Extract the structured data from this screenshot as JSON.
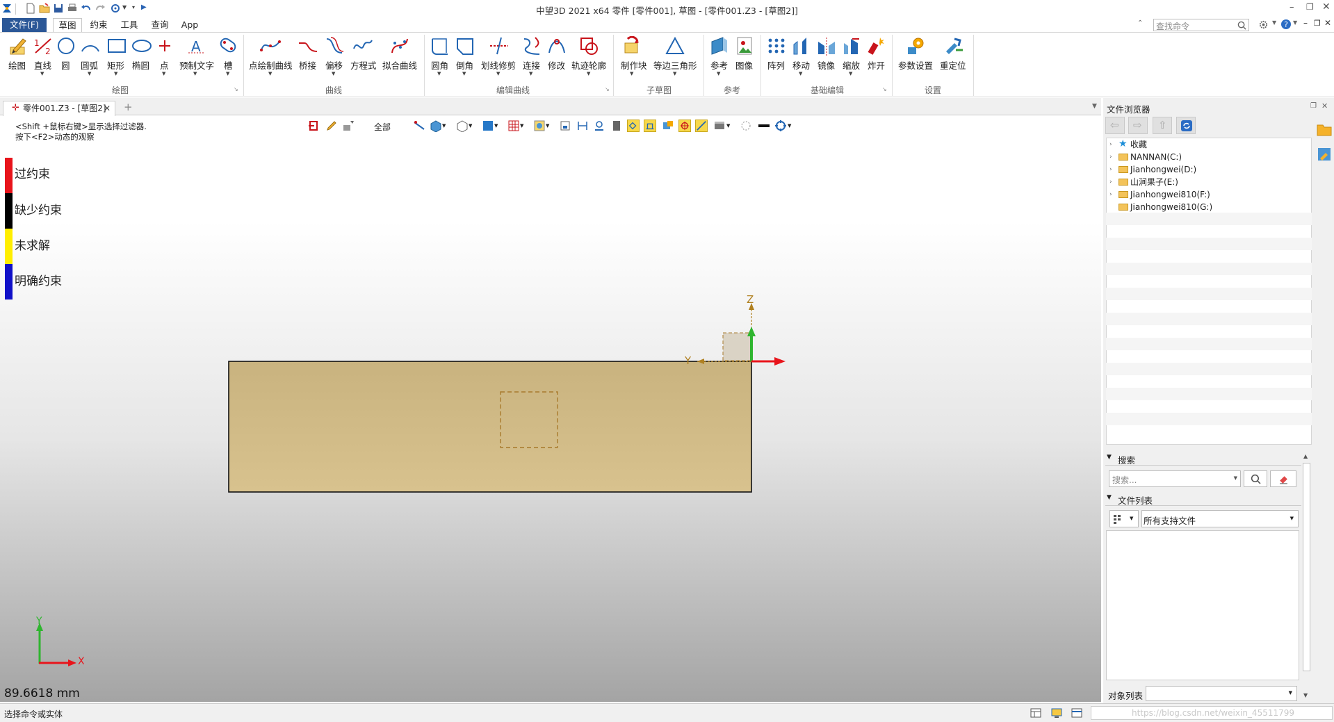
{
  "app": {
    "title": "中望3D 2021 x64      零件 [零件001], 草图 - [零件001.Z3 - [草图2]]",
    "command_search_placeholder": "查找命令"
  },
  "menubar": {
    "file": "文件(F)",
    "tabs": [
      "草图",
      "约束",
      "工具",
      "查询",
      "App"
    ]
  },
  "ribbon": {
    "groups": {
      "draw": "绘图",
      "curve": "曲线",
      "edit_curve": "编辑曲线",
      "sub_sketch": "子草图",
      "reference": "参考",
      "basic_edit": "基础编辑",
      "settings": "设置"
    },
    "tools": {
      "sketch": "绘图",
      "line": "直线",
      "circle": "圆",
      "arc": "圆弧",
      "rect": "矩形",
      "ellipse": "椭圆",
      "point": "点",
      "pretext": "预制文字",
      "slot": "槽",
      "pointcurve": "点绘制曲线",
      "bridge": "桥接",
      "offset": "偏移",
      "equation": "方程式",
      "fit": "拟合曲线",
      "fillet": "圆角",
      "chamfer": "倒角",
      "trim": "划线修剪",
      "connect": "连接",
      "modify": "修改",
      "trace": "轨迹轮廓",
      "block": "制作块",
      "triangle": "等边三角形",
      "ref": "参考",
      "image": "图像",
      "array": "阵列",
      "move": "移动",
      "mirror": "镜像",
      "scale": "缩放",
      "explode": "炸开",
      "param": "参数设置",
      "relocate": "重定位"
    }
  },
  "document_tab": {
    "label": "零件001.Z3 - [草图2]"
  },
  "viewport": {
    "hint_line1": "<Shift +鼠标右键>显示选择过滤器.",
    "hint_line2": "按下<F2>动态的观察",
    "filter_label": "全部",
    "legend": [
      {
        "label": "过约束",
        "color": "#e8141b"
      },
      {
        "label": "缺少约束",
        "color": "#000000"
      },
      {
        "label": "未求解",
        "color": "#ffee00"
      },
      {
        "label": "明确约束",
        "color": "#1010c8"
      }
    ],
    "axis_z": "Z",
    "axis_y": "Y",
    "axis_x": "X",
    "triad_y": "Y",
    "triad_x": "X",
    "measurement": "89.6618 mm",
    "sketch_fill": "#d3bd88"
  },
  "status": {
    "text": "选择命令或实体",
    "watermark": "https://blog.csdn.net/weixin_45511799"
  },
  "browser": {
    "title": "文件浏览器",
    "tree": [
      {
        "label": "收藏",
        "type": "star",
        "expand": true
      },
      {
        "label": "NANNAN(C:)",
        "type": "folder",
        "expand": true
      },
      {
        "label": "Jianhongwei(D:)",
        "type": "folder",
        "expand": true
      },
      {
        "label": "山涧果子(E:)",
        "type": "folder",
        "expand": true
      },
      {
        "label": "Jianhongwei810(F:)",
        "type": "folder",
        "expand": true
      },
      {
        "label": "Jianhongwei810(G:)",
        "type": "folder",
        "expand": false
      }
    ],
    "search_section": "搜索",
    "search_placeholder": "搜索...",
    "file_list_section": "文件列表",
    "file_filter": "所有支持文件",
    "object_list_label": "对象列表"
  }
}
